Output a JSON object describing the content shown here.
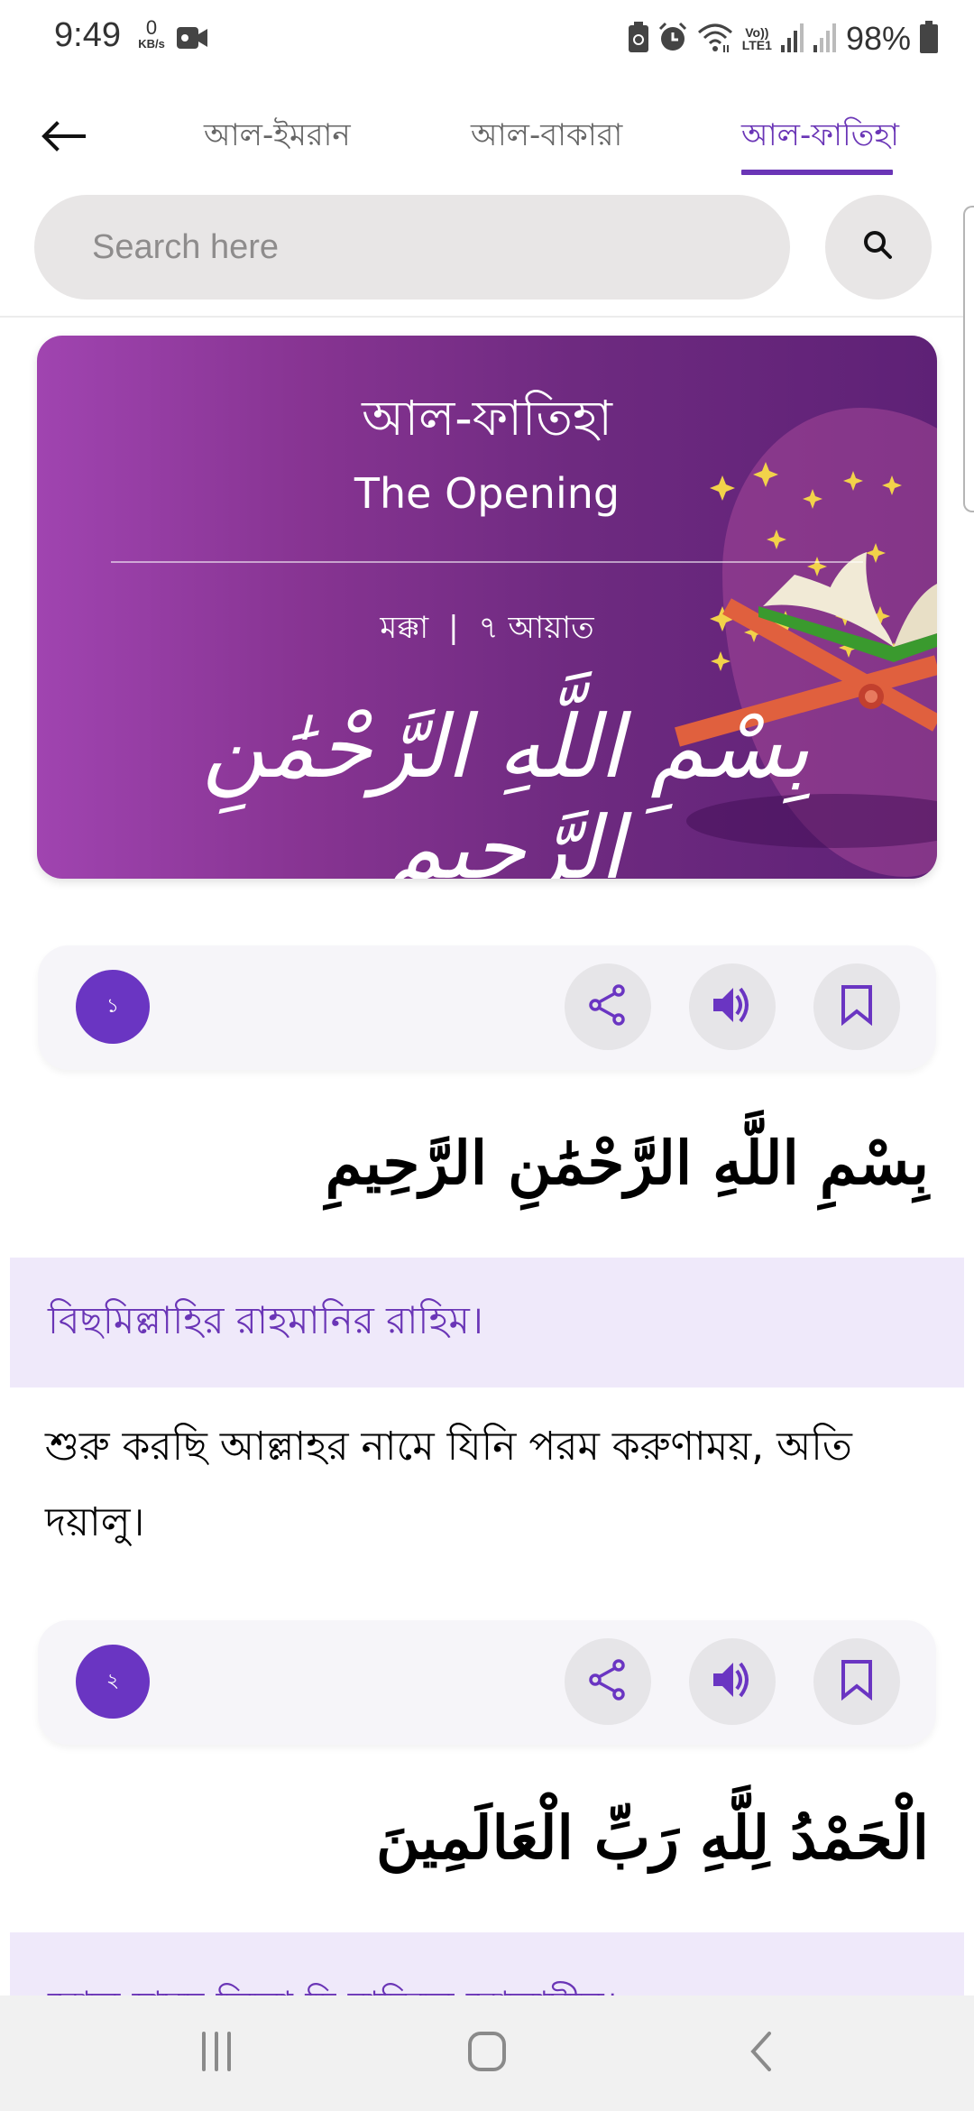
{
  "status_bar": {
    "time": "9:49",
    "net_speed_value": "0",
    "net_speed_unit": "KB/s",
    "icons": [
      "video-camera-icon",
      "battery-saver-icon",
      "alarm-icon",
      "wifi-icon",
      "volte-lte-icon",
      "signal-icon",
      "signal-icon-2",
      "battery-icon"
    ],
    "volte_label": "Vo))",
    "lte_label": "LTE1",
    "battery_percent": "98%"
  },
  "header": {
    "back_icon": "arrow-left-icon",
    "tabs": [
      {
        "label": "আল-ইমরান",
        "active": false
      },
      {
        "label": "আল-বাকারা",
        "active": false
      },
      {
        "label": "আল-ফাতিহা",
        "active": true
      }
    ],
    "accent_color": "#6a35b6"
  },
  "search": {
    "placeholder": "Search here",
    "value": "",
    "button_icon": "search-icon"
  },
  "surah_banner": {
    "title": "আল-ফাতিহা",
    "subtitle": "The Opening",
    "revelation_place": "মক্কা",
    "separator": "|",
    "ayah_count": "৭ আয়াত",
    "calligraphy": "بِسْمِ اللَّهِ الرَّحْمَٰنِ الرَّحِيمِ"
  },
  "verses": [
    {
      "number": "১",
      "arabic": "بِسْمِ اللَّهِ الرَّحْمَٰنِ الرَّحِيمِ",
      "transliteration": "বিছমিল্লাহির রাহমানির রাহিম।",
      "translation": "শুরু করছি আল্লাহর নামে যিনি পরম করুণাময়, অতি দয়ালু।"
    },
    {
      "number": "২",
      "arabic": "الْحَمْدُ لِلَّهِ رَبِّ الْعَالَمِينَ",
      "transliteration": "আল হামদু লিল্লা হি রাব্বিল আলামীন।",
      "translation": ""
    }
  ],
  "verse_actions": {
    "share_icon": "share-icon",
    "audio_icon": "speaker-icon",
    "bookmark_icon": "bookmark-icon"
  },
  "nav_bar": {
    "recents_icon": "recent-apps-icon",
    "home_icon": "home-icon",
    "back_icon": "back-chevron-icon"
  }
}
